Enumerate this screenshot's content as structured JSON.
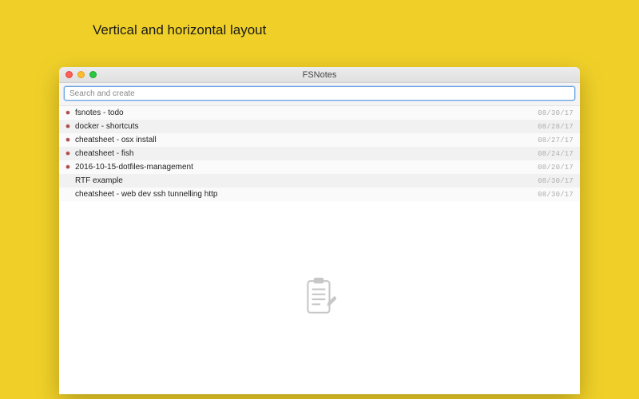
{
  "page": {
    "heading": "Vertical and horizontal layout"
  },
  "window": {
    "title": "FSNotes",
    "search": {
      "placeholder": "Search and create",
      "value": ""
    },
    "notes": [
      {
        "pinned": true,
        "title": "fsnotes - todo",
        "date": "08/30/17"
      },
      {
        "pinned": true,
        "title": "docker - shortcuts",
        "date": "08/28/17"
      },
      {
        "pinned": true,
        "title": "cheatsheet - osx install",
        "date": "08/27/17"
      },
      {
        "pinned": true,
        "title": "cheatsheet - fish",
        "date": "08/24/17"
      },
      {
        "pinned": true,
        "title": "2016-10-15-dotfiles-management",
        "date": "08/20/17"
      },
      {
        "pinned": false,
        "title": "RTF example",
        "date": "08/30/17"
      },
      {
        "pinned": false,
        "title": "cheatsheet - web dev ssh tunnelling http",
        "date": "08/30/17"
      }
    ]
  },
  "colors": {
    "bg": "#f0d028"
  }
}
